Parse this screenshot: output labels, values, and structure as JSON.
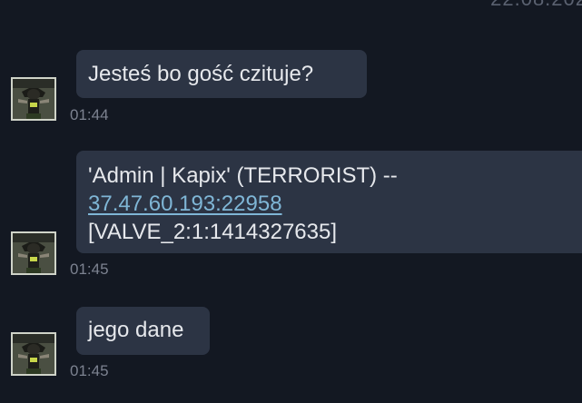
{
  "header": {
    "date_stamp": "22.08.202"
  },
  "messages": [
    {
      "text": "Jesteś bo gość czituje?",
      "time": "01:44"
    },
    {
      "line1": "'Admin | Kapix' (TERRORIST)   --",
      "link": "37.47.60.193:22958",
      "line3": "[VALVE_2:1:1414327635]",
      "time": "01:45"
    },
    {
      "text": "jego dane",
      "time": "01:45"
    }
  ],
  "colors": {
    "background": "#131822",
    "bubble": "#2c3444",
    "text": "#e6e8ec",
    "link": "#7fb6d6",
    "time": "#7c8290"
  }
}
